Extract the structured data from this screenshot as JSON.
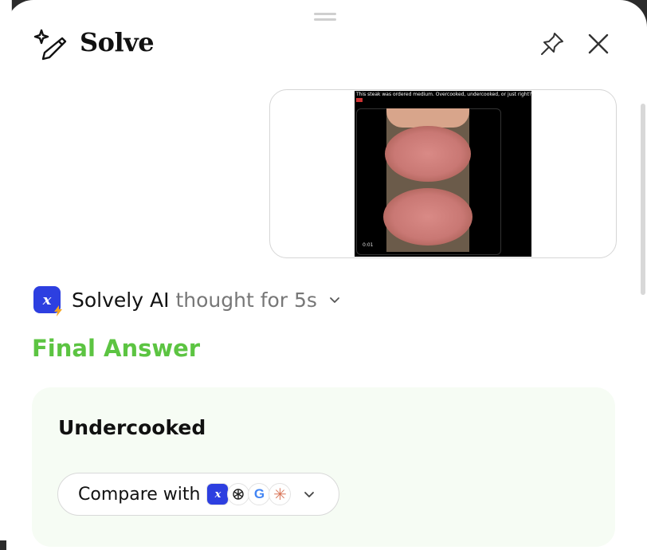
{
  "window": {
    "title": "Solve"
  },
  "header": {
    "pin_icon": "pin-icon",
    "close_icon": "close-icon"
  },
  "screenshot": {
    "caption": "This steak was ordered medium. Overcooked, undercooked, or just right?",
    "timestamp": "0:01"
  },
  "response": {
    "bot_name": "Solvely AI",
    "thought_text": "thought for 5s",
    "final_answer_label": "Final Answer",
    "answer": "Undercooked",
    "compare_label": "Compare with",
    "compare_models": [
      "solvely-icon",
      "openai-icon",
      "google-icon",
      "claude-icon"
    ]
  },
  "colors": {
    "accent_green": "#5cc442",
    "brand_blue": "#2d3fe0",
    "answer_bg": "#f6fcf4"
  }
}
